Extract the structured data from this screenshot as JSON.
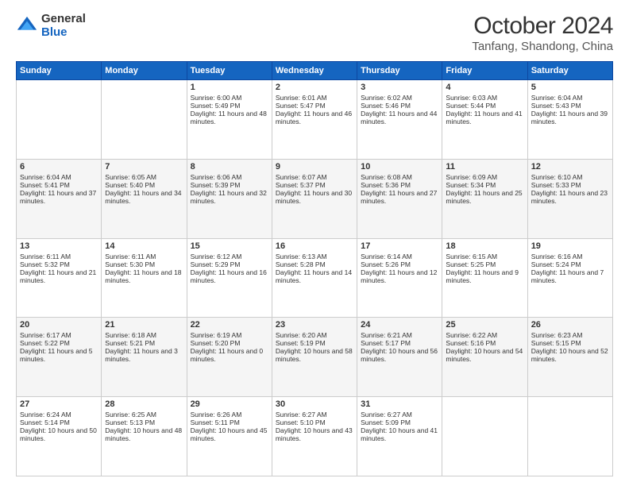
{
  "logo": {
    "general": "General",
    "blue": "Blue"
  },
  "header": {
    "month": "October 2024",
    "location": "Tanfang, Shandong, China"
  },
  "weekdays": [
    "Sunday",
    "Monday",
    "Tuesday",
    "Wednesday",
    "Thursday",
    "Friday",
    "Saturday"
  ],
  "weeks": [
    [
      {
        "day": "",
        "sunrise": "",
        "sunset": "",
        "daylight": ""
      },
      {
        "day": "",
        "sunrise": "",
        "sunset": "",
        "daylight": ""
      },
      {
        "day": "1",
        "sunrise": "Sunrise: 6:00 AM",
        "sunset": "Sunset: 5:49 PM",
        "daylight": "Daylight: 11 hours and 48 minutes."
      },
      {
        "day": "2",
        "sunrise": "Sunrise: 6:01 AM",
        "sunset": "Sunset: 5:47 PM",
        "daylight": "Daylight: 11 hours and 46 minutes."
      },
      {
        "day": "3",
        "sunrise": "Sunrise: 6:02 AM",
        "sunset": "Sunset: 5:46 PM",
        "daylight": "Daylight: 11 hours and 44 minutes."
      },
      {
        "day": "4",
        "sunrise": "Sunrise: 6:03 AM",
        "sunset": "Sunset: 5:44 PM",
        "daylight": "Daylight: 11 hours and 41 minutes."
      },
      {
        "day": "5",
        "sunrise": "Sunrise: 6:04 AM",
        "sunset": "Sunset: 5:43 PM",
        "daylight": "Daylight: 11 hours and 39 minutes."
      }
    ],
    [
      {
        "day": "6",
        "sunrise": "Sunrise: 6:04 AM",
        "sunset": "Sunset: 5:41 PM",
        "daylight": "Daylight: 11 hours and 37 minutes."
      },
      {
        "day": "7",
        "sunrise": "Sunrise: 6:05 AM",
        "sunset": "Sunset: 5:40 PM",
        "daylight": "Daylight: 11 hours and 34 minutes."
      },
      {
        "day": "8",
        "sunrise": "Sunrise: 6:06 AM",
        "sunset": "Sunset: 5:39 PM",
        "daylight": "Daylight: 11 hours and 32 minutes."
      },
      {
        "day": "9",
        "sunrise": "Sunrise: 6:07 AM",
        "sunset": "Sunset: 5:37 PM",
        "daylight": "Daylight: 11 hours and 30 minutes."
      },
      {
        "day": "10",
        "sunrise": "Sunrise: 6:08 AM",
        "sunset": "Sunset: 5:36 PM",
        "daylight": "Daylight: 11 hours and 27 minutes."
      },
      {
        "day": "11",
        "sunrise": "Sunrise: 6:09 AM",
        "sunset": "Sunset: 5:34 PM",
        "daylight": "Daylight: 11 hours and 25 minutes."
      },
      {
        "day": "12",
        "sunrise": "Sunrise: 6:10 AM",
        "sunset": "Sunset: 5:33 PM",
        "daylight": "Daylight: 11 hours and 23 minutes."
      }
    ],
    [
      {
        "day": "13",
        "sunrise": "Sunrise: 6:11 AM",
        "sunset": "Sunset: 5:32 PM",
        "daylight": "Daylight: 11 hours and 21 minutes."
      },
      {
        "day": "14",
        "sunrise": "Sunrise: 6:11 AM",
        "sunset": "Sunset: 5:30 PM",
        "daylight": "Daylight: 11 hours and 18 minutes."
      },
      {
        "day": "15",
        "sunrise": "Sunrise: 6:12 AM",
        "sunset": "Sunset: 5:29 PM",
        "daylight": "Daylight: 11 hours and 16 minutes."
      },
      {
        "day": "16",
        "sunrise": "Sunrise: 6:13 AM",
        "sunset": "Sunset: 5:28 PM",
        "daylight": "Daylight: 11 hours and 14 minutes."
      },
      {
        "day": "17",
        "sunrise": "Sunrise: 6:14 AM",
        "sunset": "Sunset: 5:26 PM",
        "daylight": "Daylight: 11 hours and 12 minutes."
      },
      {
        "day": "18",
        "sunrise": "Sunrise: 6:15 AM",
        "sunset": "Sunset: 5:25 PM",
        "daylight": "Daylight: 11 hours and 9 minutes."
      },
      {
        "day": "19",
        "sunrise": "Sunrise: 6:16 AM",
        "sunset": "Sunset: 5:24 PM",
        "daylight": "Daylight: 11 hours and 7 minutes."
      }
    ],
    [
      {
        "day": "20",
        "sunrise": "Sunrise: 6:17 AM",
        "sunset": "Sunset: 5:22 PM",
        "daylight": "Daylight: 11 hours and 5 minutes."
      },
      {
        "day": "21",
        "sunrise": "Sunrise: 6:18 AM",
        "sunset": "Sunset: 5:21 PM",
        "daylight": "Daylight: 11 hours and 3 minutes."
      },
      {
        "day": "22",
        "sunrise": "Sunrise: 6:19 AM",
        "sunset": "Sunset: 5:20 PM",
        "daylight": "Daylight: 11 hours and 0 minutes."
      },
      {
        "day": "23",
        "sunrise": "Sunrise: 6:20 AM",
        "sunset": "Sunset: 5:19 PM",
        "daylight": "Daylight: 10 hours and 58 minutes."
      },
      {
        "day": "24",
        "sunrise": "Sunrise: 6:21 AM",
        "sunset": "Sunset: 5:17 PM",
        "daylight": "Daylight: 10 hours and 56 minutes."
      },
      {
        "day": "25",
        "sunrise": "Sunrise: 6:22 AM",
        "sunset": "Sunset: 5:16 PM",
        "daylight": "Daylight: 10 hours and 54 minutes."
      },
      {
        "day": "26",
        "sunrise": "Sunrise: 6:23 AM",
        "sunset": "Sunset: 5:15 PM",
        "daylight": "Daylight: 10 hours and 52 minutes."
      }
    ],
    [
      {
        "day": "27",
        "sunrise": "Sunrise: 6:24 AM",
        "sunset": "Sunset: 5:14 PM",
        "daylight": "Daylight: 10 hours and 50 minutes."
      },
      {
        "day": "28",
        "sunrise": "Sunrise: 6:25 AM",
        "sunset": "Sunset: 5:13 PM",
        "daylight": "Daylight: 10 hours and 48 minutes."
      },
      {
        "day": "29",
        "sunrise": "Sunrise: 6:26 AM",
        "sunset": "Sunset: 5:11 PM",
        "daylight": "Daylight: 10 hours and 45 minutes."
      },
      {
        "day": "30",
        "sunrise": "Sunrise: 6:27 AM",
        "sunset": "Sunset: 5:10 PM",
        "daylight": "Daylight: 10 hours and 43 minutes."
      },
      {
        "day": "31",
        "sunrise": "Sunrise: 6:27 AM",
        "sunset": "Sunset: 5:09 PM",
        "daylight": "Daylight: 10 hours and 41 minutes."
      },
      {
        "day": "",
        "sunrise": "",
        "sunset": "",
        "daylight": ""
      },
      {
        "day": "",
        "sunrise": "",
        "sunset": "",
        "daylight": ""
      }
    ]
  ]
}
